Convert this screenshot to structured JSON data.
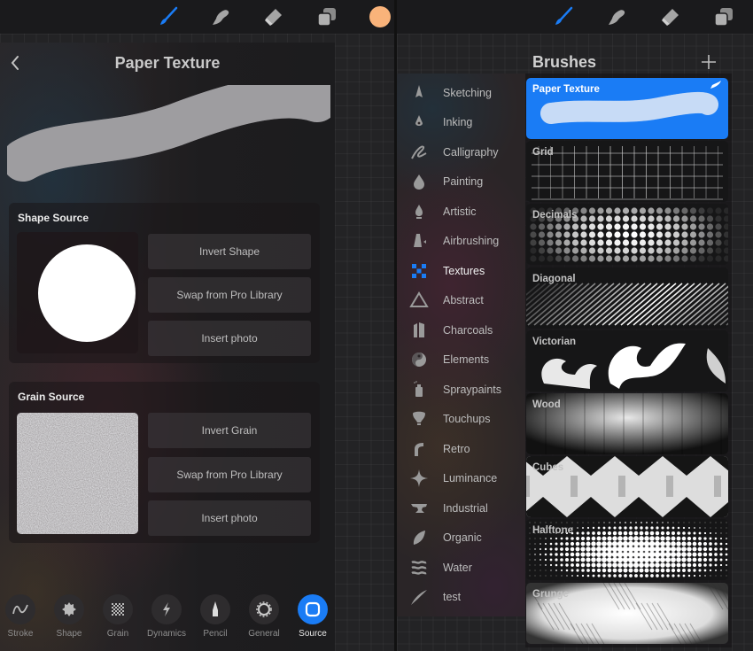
{
  "toolbar": {
    "tools": [
      {
        "name": "brush",
        "icon": "paintbrush-icon",
        "active": true
      },
      {
        "name": "smudge",
        "icon": "smudge-finger-icon",
        "active": false
      },
      {
        "name": "eraser",
        "icon": "eraser-icon",
        "active": false
      },
      {
        "name": "layers",
        "icon": "layers-icon",
        "active": false
      }
    ],
    "color": "#f9b37a",
    "accent": "#1a7cf5"
  },
  "studio": {
    "back_icon": "chevron-left-icon",
    "title": "Paper Texture",
    "shape_source": {
      "title": "Shape Source",
      "buttons": [
        "Invert Shape",
        "Swap from Pro Library",
        "Insert photo"
      ]
    },
    "grain_source": {
      "title": "Grain Source",
      "buttons": [
        "Invert Grain",
        "Swap from Pro Library",
        "Insert photo"
      ]
    },
    "tabs": [
      {
        "label": "Stroke",
        "icon": "stroke-wave-icon",
        "active": false
      },
      {
        "label": "Shape",
        "icon": "shape-burst-icon",
        "active": false
      },
      {
        "label": "Grain",
        "icon": "grain-checker-icon",
        "active": false
      },
      {
        "label": "Dynamics",
        "icon": "lightning-icon",
        "active": false
      },
      {
        "label": "Pencil",
        "icon": "pencil-nib-icon",
        "active": false
      },
      {
        "label": "General",
        "icon": "gear-icon",
        "active": false
      },
      {
        "label": "Source",
        "icon": "source-square-icon",
        "active": true
      }
    ]
  },
  "library": {
    "title": "Brushes",
    "add_icon": "plus-icon",
    "sets": [
      {
        "label": "Sketching",
        "icon": "sketching-icon"
      },
      {
        "label": "Inking",
        "icon": "ink-nib-icon"
      },
      {
        "label": "Calligraphy",
        "icon": "calligraphy-icon"
      },
      {
        "label": "Painting",
        "icon": "paint-drop-icon"
      },
      {
        "label": "Artistic",
        "icon": "artistic-icon"
      },
      {
        "label": "Airbrushing",
        "icon": "airbrush-icon"
      },
      {
        "label": "Textures",
        "icon": "textures-checker-icon",
        "active": true
      },
      {
        "label": "Abstract",
        "icon": "triangle-icon"
      },
      {
        "label": "Charcoals",
        "icon": "charcoal-icon"
      },
      {
        "label": "Elements",
        "icon": "yin-yang-icon"
      },
      {
        "label": "Spraypaints",
        "icon": "spray-can-icon"
      },
      {
        "label": "Touchups",
        "icon": "touchup-icon"
      },
      {
        "label": "Retro",
        "icon": "retro-arc-icon"
      },
      {
        "label": "Luminance",
        "icon": "sparkle-icon"
      },
      {
        "label": "Industrial",
        "icon": "anvil-icon"
      },
      {
        "label": "Organic",
        "icon": "leaf-icon"
      },
      {
        "label": "Water",
        "icon": "waves-icon"
      },
      {
        "label": "test",
        "icon": "stroke-swoosh-icon"
      }
    ],
    "brushes": [
      {
        "label": "Paper Texture",
        "selected": true,
        "art": "paper"
      },
      {
        "label": "Grid",
        "art": "grid"
      },
      {
        "label": "Decimals",
        "art": "dots"
      },
      {
        "label": "Diagonal",
        "art": "diagonal"
      },
      {
        "label": "Victorian",
        "art": "victorian"
      },
      {
        "label": "Wood",
        "art": "wood"
      },
      {
        "label": "Cubes",
        "art": "cubes"
      },
      {
        "label": "Halftone",
        "art": "halftone"
      },
      {
        "label": "Grunge",
        "art": "grunge"
      }
    ]
  }
}
